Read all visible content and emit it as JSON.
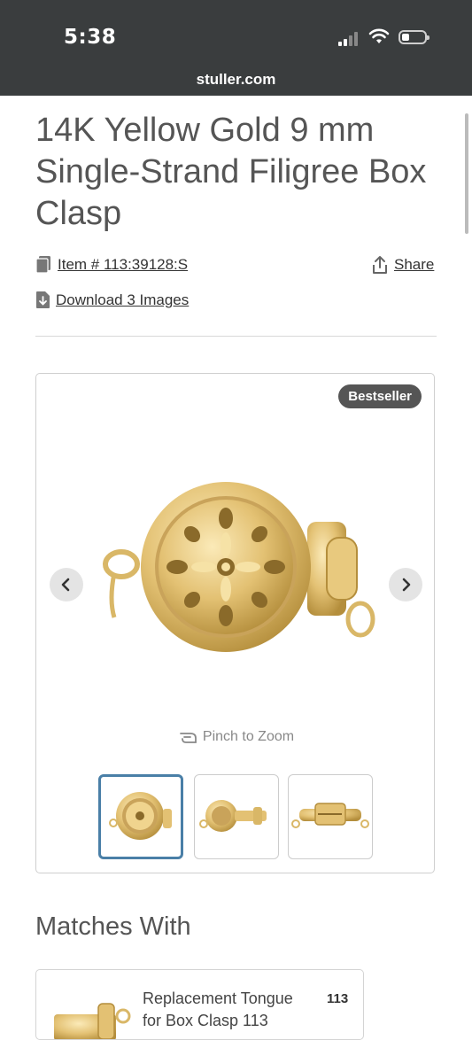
{
  "status_bar": {
    "time": "5:38"
  },
  "browser": {
    "url": "stuller.com"
  },
  "product": {
    "title": "14K Yellow Gold 9 mm Single-Strand Filigree Box Clasp",
    "item_number": "Item # 113:39128:S",
    "share_label": "Share",
    "download_label": "Download 3 Images"
  },
  "gallery": {
    "badge": "Bestseller",
    "pinch_hint": "Pinch to Zoom",
    "thumbnail_count": 3,
    "active_index": 0
  },
  "matches": {
    "heading": "Matches With",
    "items": [
      {
        "title": "Replacement Tongue for Box Clasp 113",
        "number": "113"
      }
    ]
  },
  "colors": {
    "status_bar": "#3a3d3e",
    "gold": "#e3c173",
    "active_thumb": "#4a7fa7",
    "badge": "#555555"
  },
  "icons": [
    "cellular-signal-icon",
    "wifi-icon",
    "battery-icon",
    "document-icon",
    "share-icon",
    "download-file-icon",
    "chevron-left-icon",
    "chevron-right-icon",
    "pinch-zoom-icon"
  ]
}
